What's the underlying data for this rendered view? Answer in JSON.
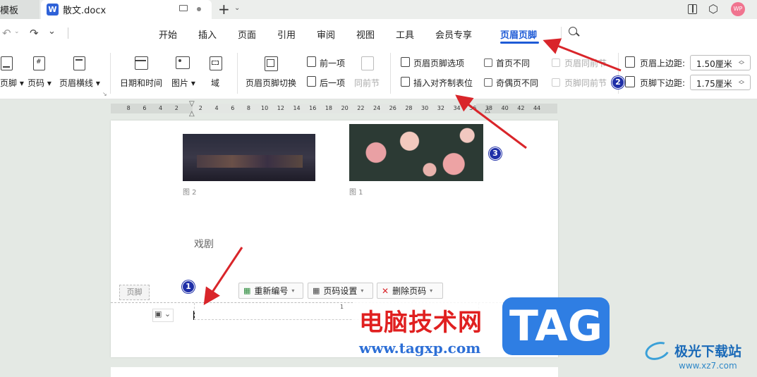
{
  "titlebar": {
    "tab_partial": "模板",
    "doc_tab": "散文.docx",
    "new_tab_icon": "plus-icon",
    "avatar": "WP"
  },
  "menu": {
    "items": [
      "开始",
      "插入",
      "页面",
      "引用",
      "审阅",
      "视图",
      "工具",
      "会员专享"
    ],
    "active": "页眉页脚"
  },
  "ribbon": {
    "header_footer_partial": "页脚",
    "page_number": "页码",
    "header_line": "页眉横线",
    "date_time": "日期和时间",
    "picture": "图片",
    "field": "域",
    "switch": "页眉页脚切换",
    "prev": "前一项",
    "next": "后一项",
    "prev_section": "同前节",
    "options": "页眉页脚选项",
    "insert_tab": "插入对齐制表位",
    "first_diff": "首页不同",
    "odd_even_diff": "奇偶页不同",
    "header_same": "页眉同前节",
    "footer_same": "页脚同前节",
    "header_margin_label": "页眉上边距:",
    "header_margin_value": "1.50厘米",
    "footer_margin_label": "页脚下边距:",
    "footer_margin_value": "1.75厘米"
  },
  "ruler": {
    "ticks": [
      "8",
      "6",
      "4",
      "2",
      "2",
      "4",
      "6",
      "8",
      "10",
      "12",
      "14",
      "16",
      "18",
      "20",
      "22",
      "24",
      "26",
      "28",
      "30",
      "32",
      "34",
      "36",
      "38",
      "40",
      "42",
      "44"
    ]
  },
  "document": {
    "caption_left": "图 2",
    "caption_right": "图 1",
    "heading": "戏剧",
    "footer_tag": "页脚",
    "renumber": "重新编号",
    "page_setup": "页码设置",
    "delete_number": "删除页码",
    "page_number_value": "1"
  },
  "annotations": {
    "badges": [
      "1",
      "2",
      "3"
    ],
    "accent": "#d9252a"
  },
  "watermark": {
    "site_name": "电脑技术网",
    "url": "www.tagxp.com",
    "tag": "TAG",
    "brand": "极光下载站",
    "brand_url": "www.xz7.com"
  }
}
